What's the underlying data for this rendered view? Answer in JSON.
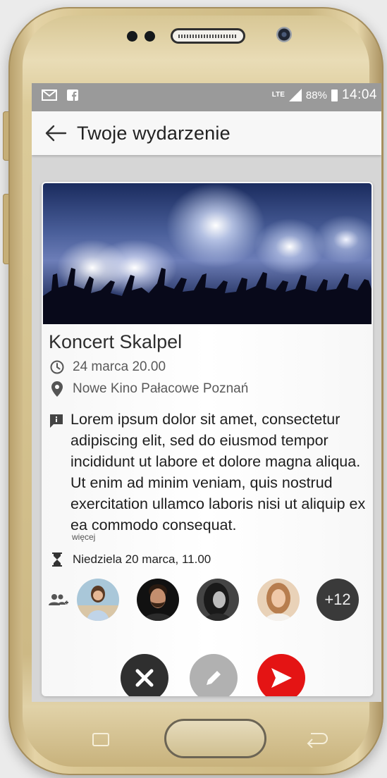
{
  "statusbar": {
    "network_type": "LTE",
    "battery": "88%",
    "time": "14:04",
    "left_icons": [
      "mail-icon",
      "facebook-icon"
    ]
  },
  "appbar": {
    "title": "Twoje wydarzenie"
  },
  "event": {
    "title": "Koncert Skalpel",
    "datetime": "24 marca 20.00",
    "place": "Nowe Kino Pałacowe Poznań",
    "description": "Lorem ipsum dolor sit amet, consectetur adipiscing elit, sed do eiusmod tempor incididunt ut labore et dolore magna aliqua. Ut enim ad minim veniam, quis nostrud exercitation ullamco laboris nisi ut aliquip ex ea commodo consequat.",
    "more_link": "więcej",
    "deadline": "Niedziela 20 marca, 11.00"
  },
  "attendees": {
    "extra_count": "+12",
    "avatars": [
      "woman-beach",
      "man-beard",
      "woman-dark",
      "woman-blonde"
    ]
  },
  "actions": [
    "close-icon",
    "edit-icon",
    "send-icon"
  ],
  "colors": {
    "send": "#e41414",
    "close": "#2f2f2f",
    "edit": "#b1b1b1",
    "statusbar": "#9a9a9a",
    "phone_gold": "#d9c692"
  }
}
